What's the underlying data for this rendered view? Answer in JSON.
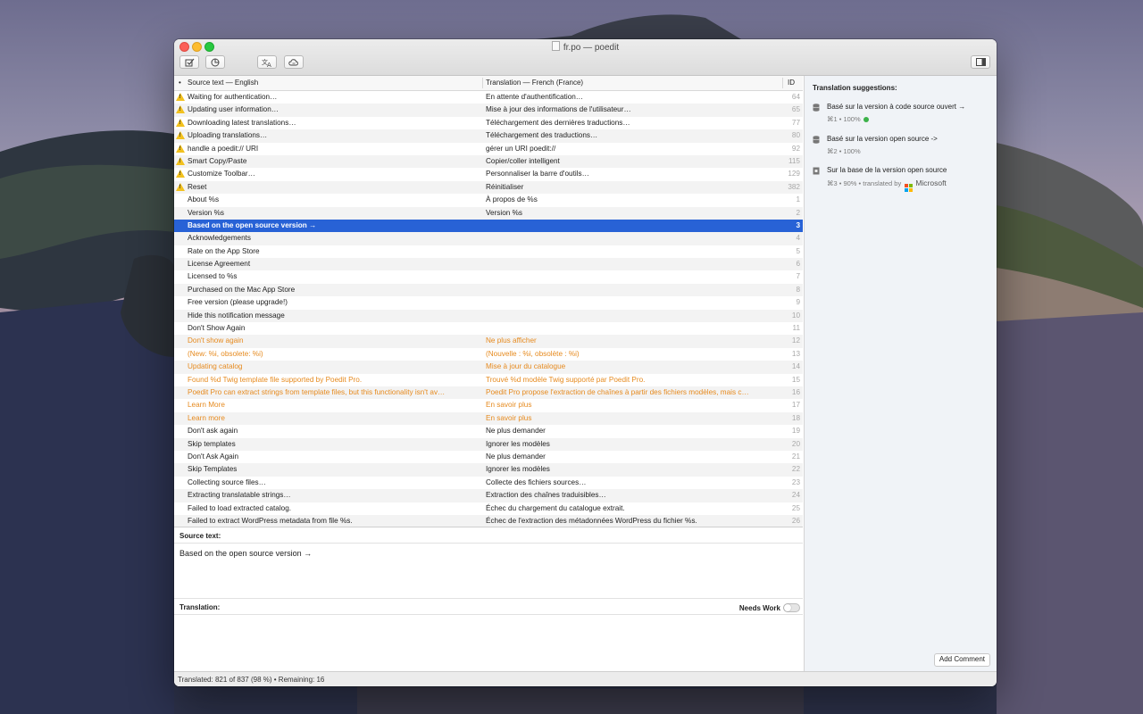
{
  "window": {
    "title": "fr.po — poedit"
  },
  "toolbar": {
    "validate_icon": "checkbox-edit-icon",
    "stats_icon": "pie-chart-icon",
    "translate_icon": "translate-icon",
    "cloud_icon": "cloud-sync-icon",
    "sidebar_icon": "sidebar-toggle-icon"
  },
  "list": {
    "headers": {
      "dot": "•",
      "source": "Source text — English",
      "translation": "Translation — French (France)",
      "id": "ID"
    },
    "rows": [
      {
        "src": "Waiting for authentication…",
        "tr": "En attente d'authentification…",
        "id": "64",
        "state": "warn"
      },
      {
        "src": "Updating user information…",
        "tr": "Mise à jour des informations de l'utilisateur…",
        "id": "65",
        "state": "warn"
      },
      {
        "src": "Downloading latest translations…",
        "tr": "Téléchargement des dernières traductions…",
        "id": "77",
        "state": "warn"
      },
      {
        "src": "Uploading translations…",
        "tr": "Téléchargement des traductions…",
        "id": "80",
        "state": "warn"
      },
      {
        "src": "handle a poedit:// URI",
        "tr": "gérer un URI poedit://",
        "id": "92",
        "state": "warn"
      },
      {
        "src": "Smart Copy/Paste",
        "tr": "Copier/coller intelligent",
        "id": "115",
        "state": "warn"
      },
      {
        "src": "Customize Toolbar…",
        "tr": "Personnaliser la barre d'outils…",
        "id": "129",
        "state": "warn"
      },
      {
        "src": "Reset",
        "tr": "Réinitialiser",
        "id": "382",
        "state": "warn"
      },
      {
        "src": "About %s",
        "tr": "À propos de %s",
        "id": "1",
        "state": "ok"
      },
      {
        "src": "Version %s",
        "tr": "Version %s",
        "id": "2",
        "state": "ok"
      },
      {
        "src": "Based on the open source version →",
        "tr": "",
        "id": "3",
        "state": "selected"
      },
      {
        "src": "Acknowledgements",
        "tr": "",
        "id": "4",
        "state": "untranslated"
      },
      {
        "src": "Rate on the App Store",
        "tr": "",
        "id": "5",
        "state": "untranslated"
      },
      {
        "src": "License Agreement",
        "tr": "",
        "id": "6",
        "state": "untranslated"
      },
      {
        "src": "Licensed to %s",
        "tr": "",
        "id": "7",
        "state": "untranslated"
      },
      {
        "src": "Purchased on the Mac App Store",
        "tr": "",
        "id": "8",
        "state": "untranslated"
      },
      {
        "src": "Free version (please upgrade!)",
        "tr": "",
        "id": "9",
        "state": "untranslated"
      },
      {
        "src": "Hide this notification message",
        "tr": "",
        "id": "10",
        "state": "untranslated"
      },
      {
        "src": "Don't Show Again",
        "tr": "",
        "id": "11",
        "state": "untranslated"
      },
      {
        "src": "Don't show again",
        "tr": "Ne plus afficher",
        "id": "12",
        "state": "fuzzy"
      },
      {
        "src": "(New: %i, obsolete: %i)",
        "tr": "(Nouvelle : %i, obsolète : %i)",
        "id": "13",
        "state": "fuzzy"
      },
      {
        "src": "Updating catalog",
        "tr": "Mise à jour du catalogue",
        "id": "14",
        "state": "fuzzy"
      },
      {
        "src": "Found %d Twig template file supported by Poedit Pro.",
        "tr": "Trouvé %d modèle Twig supporté par Poedit Pro.",
        "id": "15",
        "state": "fuzzy"
      },
      {
        "src": "Poedit Pro can extract strings from template files, but this functionality isn't av…",
        "tr": "Poedit Pro propose l'extraction de chaînes à partir des fichiers modèles, mais c…",
        "id": "16",
        "state": "fuzzy"
      },
      {
        "src": "Learn More",
        "tr": "En savoir plus",
        "id": "17",
        "state": "fuzzy"
      },
      {
        "src": "Learn more",
        "tr": "En savoir plus",
        "id": "18",
        "state": "fuzzy"
      },
      {
        "src": "Don't ask again",
        "tr": "Ne plus demander",
        "id": "19",
        "state": "ok"
      },
      {
        "src": "Skip templates",
        "tr": "Ignorer les modèles",
        "id": "20",
        "state": "ok"
      },
      {
        "src": "Don't Ask Again",
        "tr": "Ne plus demander",
        "id": "21",
        "state": "ok"
      },
      {
        "src": "Skip Templates",
        "tr": "Ignorer les modèles",
        "id": "22",
        "state": "ok"
      },
      {
        "src": "Collecting source files…",
        "tr": "Collecte des fichiers sources…",
        "id": "23",
        "state": "ok"
      },
      {
        "src": "Extracting translatable strings…",
        "tr": "Extraction des chaînes traduisibles…",
        "id": "24",
        "state": "ok"
      },
      {
        "src": "Failed to load extracted catalog.",
        "tr": "Échec du chargement du catalogue extrait.",
        "id": "25",
        "state": "ok"
      },
      {
        "src": "Failed to extract WordPress metadata from file %s.",
        "tr": "Échec de l'extraction des métadonnées WordPress du fichier %s.",
        "id": "26",
        "state": "ok"
      }
    ]
  },
  "editor": {
    "source_label": "Source text:",
    "source_value": "Based on the open source version →",
    "translation_label": "Translation:",
    "needs_work_label": "Needs Work",
    "translation_value": ""
  },
  "sidebar": {
    "title": "Translation suggestions:",
    "suggestions": [
      {
        "text": "Basé sur la version à code source ouvert →",
        "meta": "⌘1 • 100%",
        "icon": "database-icon"
      },
      {
        "text": "Basé sur la version open source ->",
        "meta": "⌘2 • 100%",
        "icon": "database-icon"
      },
      {
        "text": "Sur la base de la version open source",
        "meta": "⌘3 • 90% • translated by",
        "icon": "machine-translation-icon",
        "provider": "Microsoft"
      }
    ],
    "add_comment_label": "Add Comment"
  },
  "status": {
    "text": "Translated: 821 of 837 (98 %)  •  Remaining: 16"
  },
  "colors": {
    "selection": "#2862d6",
    "fuzzy": "#e68a1e",
    "warning": "#f2c11e"
  }
}
